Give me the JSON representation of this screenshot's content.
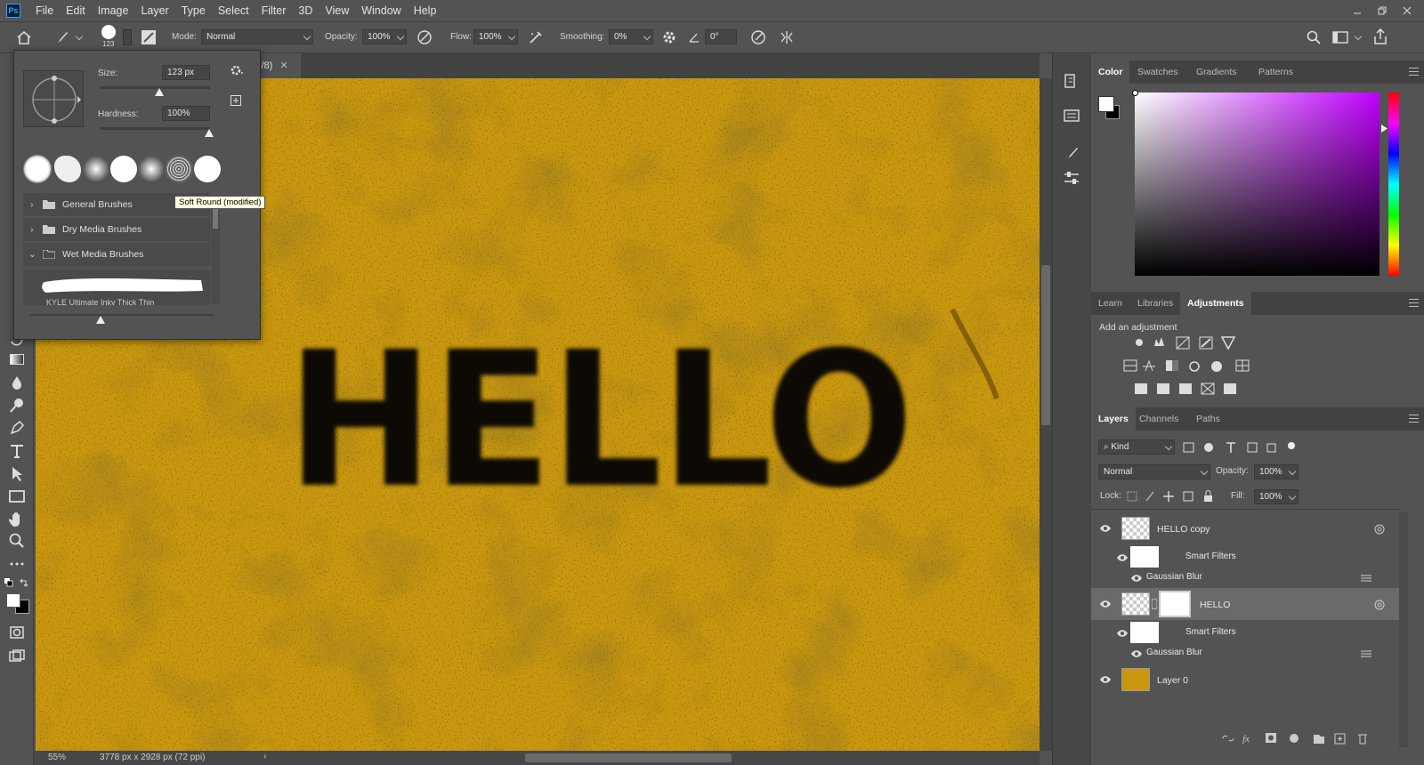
{
  "app": {
    "logo": "Ps",
    "menu": [
      "File",
      "Edit",
      "Image",
      "Layer",
      "Type",
      "Select",
      "Filter",
      "3D",
      "View",
      "Window",
      "Help"
    ]
  },
  "options": {
    "brush_size_num": "123",
    "mode_label": "Mode:",
    "mode_value": "Normal",
    "opacity_label": "Opacity:",
    "opacity_value": "100%",
    "flow_label": "Flow:",
    "flow_value": "100%",
    "smoothing_label": "Smoothing:",
    "smoothing_value": "0%",
    "angle_value": "0°"
  },
  "document": {
    "tab_fragment": "k/8)",
    "text": "HELLO",
    "zoom": "55%",
    "info": "3778 px x 2928 px (72 ppi)"
  },
  "brush_popup": {
    "size_label": "Size:",
    "size_value": "123 px",
    "hardness_label": "Hardness:",
    "hardness_value": "100%",
    "tooltip": "Soft Round (modified)",
    "folders": [
      "General Brushes",
      "Dry Media Brushes",
      "Wet Media Brushes"
    ],
    "truncated_label": "KYLE Ultimate Inky Thick Thin"
  },
  "color_panel": {
    "tabs": [
      "Color",
      "Swatches",
      "Gradients",
      "Patterns"
    ],
    "hue_color": "#c000ff"
  },
  "adjust_panel": {
    "tabs": [
      "Learn",
      "Libraries",
      "Adjustments"
    ],
    "add_label": "Add an adjustment"
  },
  "layers_panel": {
    "tabs": [
      "Layers",
      "Channels",
      "Paths"
    ],
    "kind_label": "Kind",
    "blend_mode": "Normal",
    "opacity_label": "Opacity:",
    "opacity_value": "100%",
    "lock_label": "Lock:",
    "fill_label": "Fill:",
    "fill_value": "100%",
    "rows": {
      "hello_copy": "HELLO copy",
      "smart_filters_1": "Smart Filters",
      "gaussian_1": "Gaussian Blur",
      "hello": "HELLO",
      "smart_filters_2": "Smart Filters",
      "gaussian_2": "Gaussian Blur",
      "layer0": "Layer 0"
    }
  }
}
